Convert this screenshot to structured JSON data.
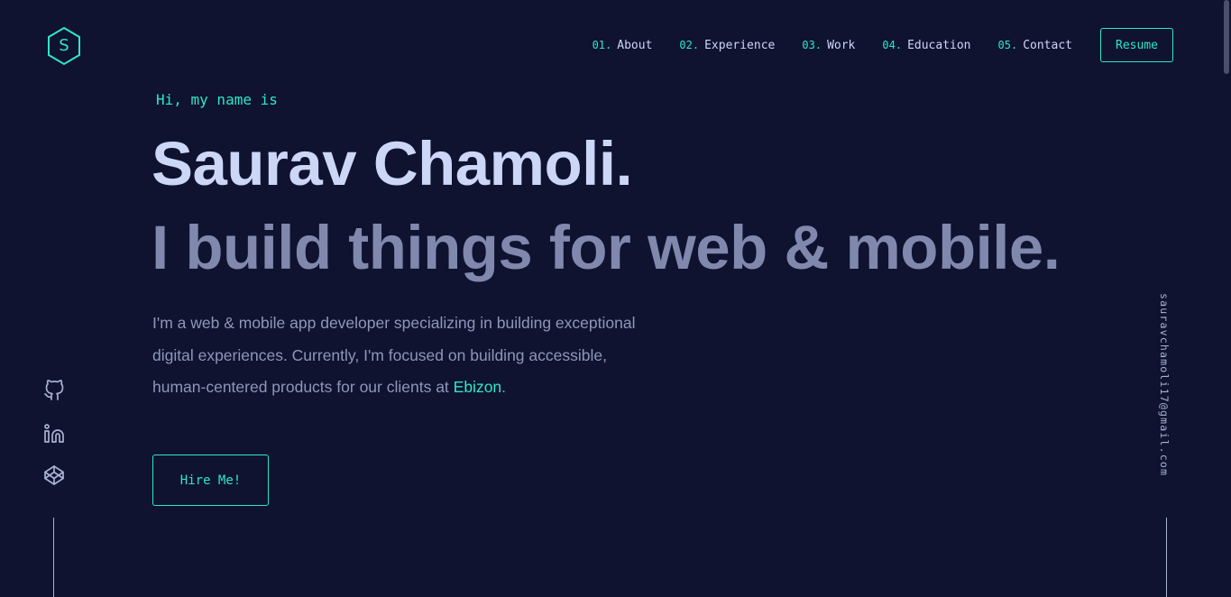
{
  "logo": {
    "letter": "S",
    "icon": "hexagon-logo-icon"
  },
  "nav": {
    "items": [
      {
        "num": "01.",
        "label": "About"
      },
      {
        "num": "02.",
        "label": "Experience"
      },
      {
        "num": "03.",
        "label": "Work"
      },
      {
        "num": "04.",
        "label": "Education"
      },
      {
        "num": "05.",
        "label": "Contact"
      }
    ],
    "resume_label": "Resume"
  },
  "hero": {
    "greeting": "Hi, my name is",
    "name": "Saurav Chamoli.",
    "tagline": "I build things for web & mobile.",
    "intro_line1": "I'm a web & mobile app developer specializing in building exceptional",
    "intro_line2": "digital experiences. Currently, I'm focused on building accessible,",
    "intro_line3_prefix": "human-centered products for our clients at ",
    "intro_company": "Ebizon",
    "intro_line3_suffix": ".",
    "cta_label": "Hire Me!"
  },
  "social": [
    {
      "icon": "github-icon"
    },
    {
      "icon": "linkedin-icon"
    },
    {
      "icon": "codepen-icon"
    }
  ],
  "email": "sauravchamoli17@gmail.com",
  "colors": {
    "background": "#0f1330",
    "accent": "#2ee6c6",
    "heading": "#ccd6f6",
    "subheading": "#8088ad",
    "body_text": "#8f96b8"
  }
}
